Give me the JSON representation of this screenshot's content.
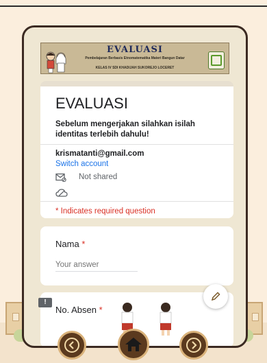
{
  "banner": {
    "title": "EVALUASI",
    "subtitle": "Pembelajaran Berbasis Etnomatematika Materi Bangun Datar",
    "school": "KELAS IV SDI KHADIJAH SUKOREJO LOCERET"
  },
  "form": {
    "title": "EVALUASI",
    "description": "Sebelum mengerjakan silahkan isilah identitas terlebih dahulu!",
    "email": "krismatanti@gmail.com",
    "switch_account": "Switch account",
    "not_shared": "Not shared",
    "required_note": "* Indicates required question"
  },
  "questions": [
    {
      "label": "Nama",
      "required_mark": "*",
      "placeholder": "Your answer"
    },
    {
      "label": "No. Absen",
      "required_mark": "*"
    }
  ],
  "icons": {
    "mail": "mail-off-icon",
    "cloud": "cloud-icon",
    "edit": "pencil-icon",
    "feedback": "feedback-icon",
    "prev": "chevron-left-icon",
    "home": "home-icon",
    "next": "chevron-right-icon"
  },
  "colors": {
    "accent_blue": "#1a73e8",
    "required_red": "#d93025",
    "frame_brown": "#3b2a22",
    "nav_brown": "#5b3a1e"
  }
}
